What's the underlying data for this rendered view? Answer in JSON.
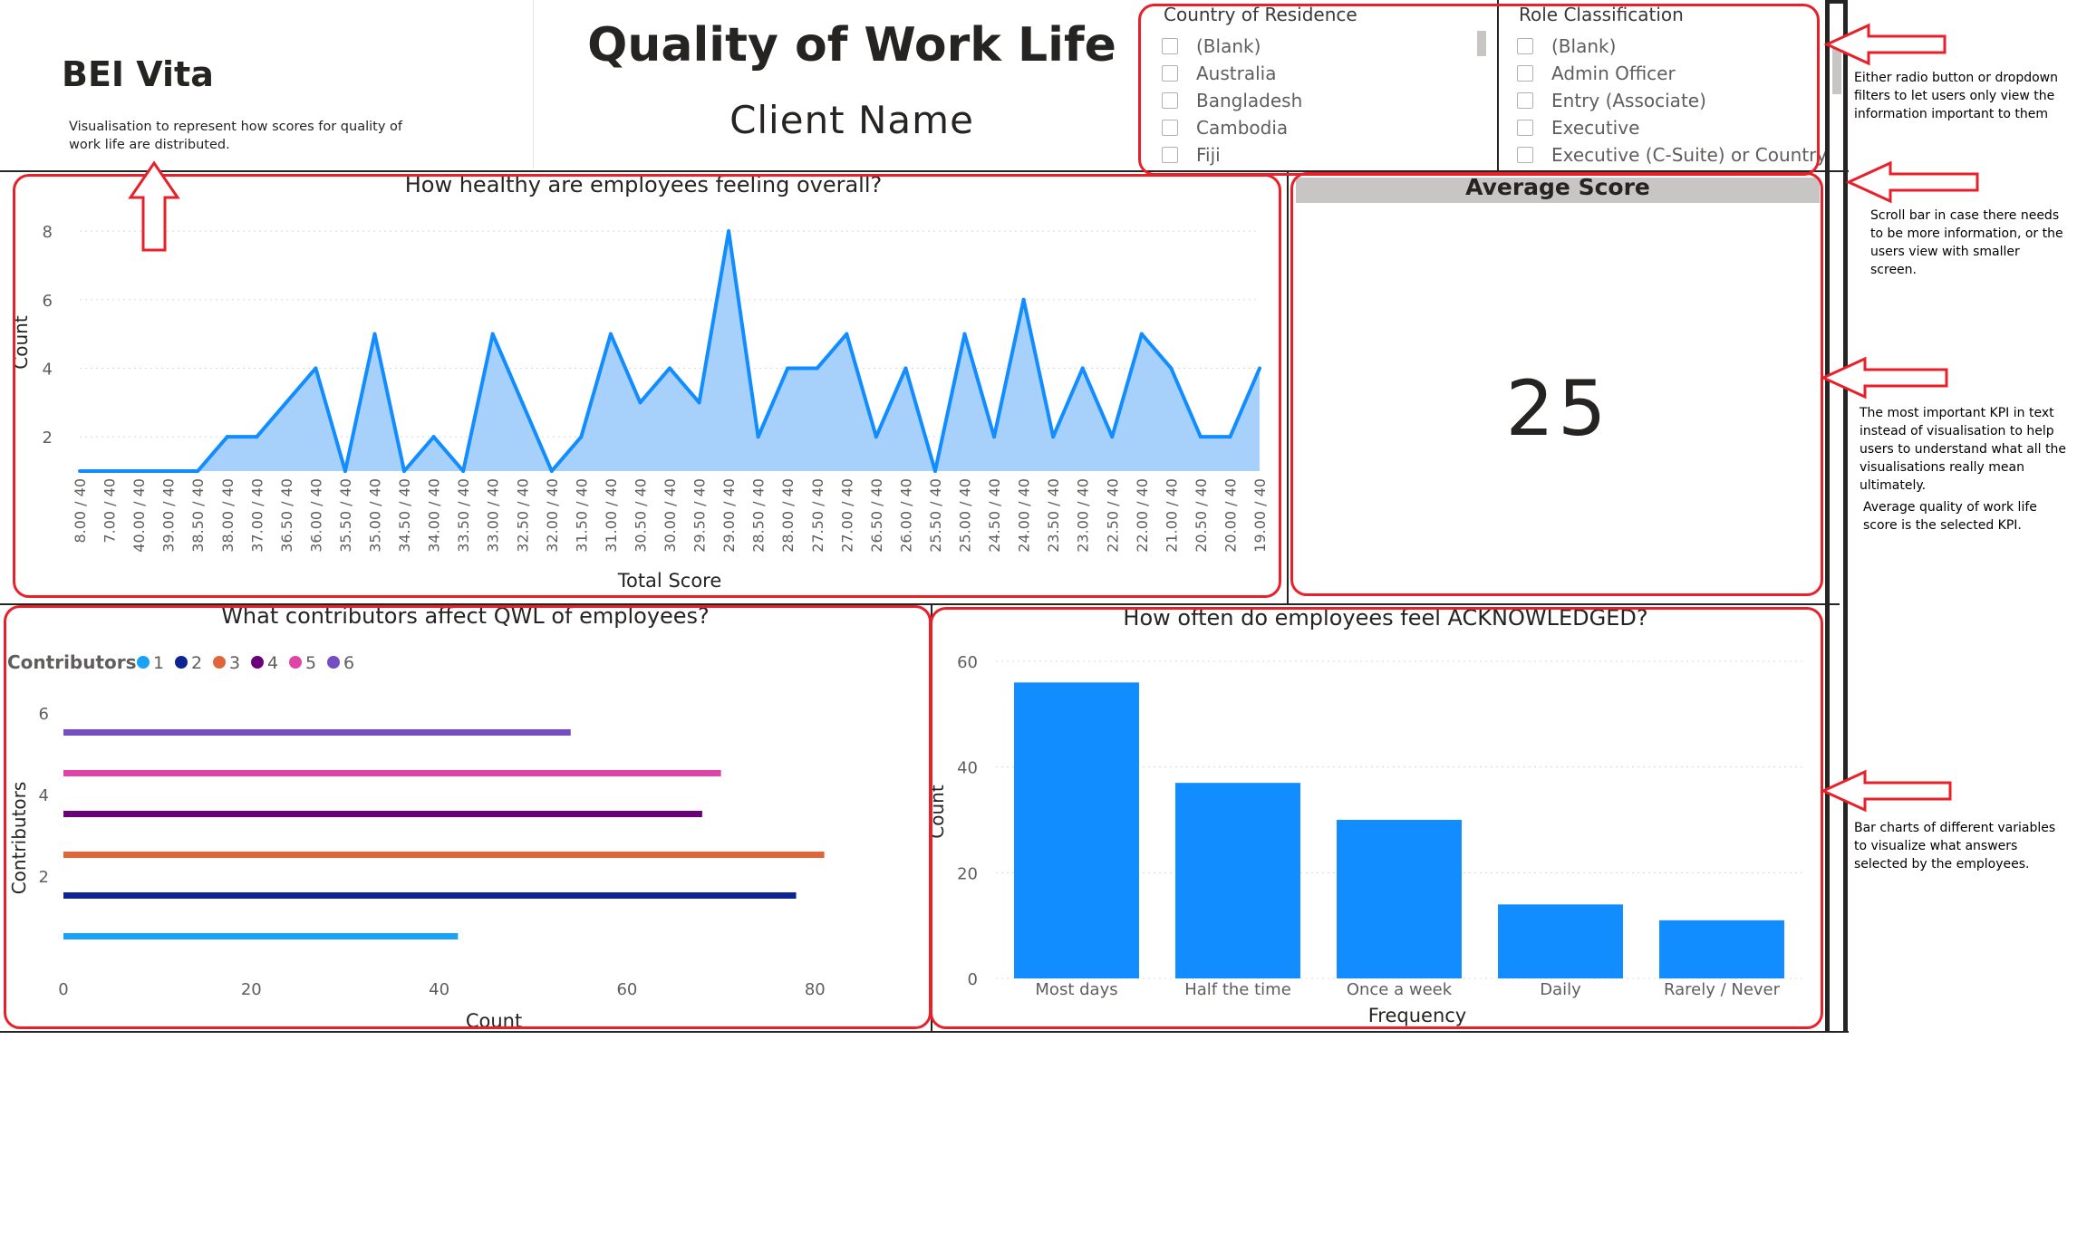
{
  "header": {
    "brand": "BEI Vita",
    "brand_description": "Visualisation to represent how scores for quality of work life are distributed.",
    "title": "Quality of Work Life",
    "client": "Client Name"
  },
  "slicers": {
    "country": {
      "title": "Country of Residence",
      "options": [
        "(Blank)",
        "Australia",
        "Bangladesh",
        "Cambodia",
        "Fiji"
      ]
    },
    "role": {
      "title": "Role Classification",
      "options": [
        "(Blank)",
        "Admin Officer",
        "Entry (Associate)",
        "Executive",
        "Executive (C-Suite) or Country H"
      ]
    }
  },
  "kpi": {
    "title": "Average Score",
    "value": "25"
  },
  "annotations": {
    "filters": "Either radio button or dropdown filters to let users only view the information important to them",
    "scroll": "Scroll bar in case there needs to be more information, or the users view with smaller screen.",
    "kpi_1": "The most important KPI in text instead of visualisation to help users to understand what all the visualisations really mean ultimately.",
    "kpi_2": "Average quality of work life score is the selected KPI.",
    "bars": "Bar charts of different variables to visualize what answers selected by the employees."
  },
  "colors": {
    "accent_red": "#e8202a",
    "powerbi_blue": "#118dff",
    "area_fill": "#a7d1fb",
    "contributors": [
      "#1aa2f6",
      "#0d2491",
      "#e0663a",
      "#6b007b",
      "#e044a7",
      "#744ec2"
    ]
  },
  "chart_data": [
    {
      "type": "area",
      "title": "How healthy are employees feeling overall?",
      "xlabel": "Total Score",
      "ylabel": "Count",
      "categories": [
        "8.00 / 40",
        "7.00 / 40",
        "40.00 / 40",
        "39.00 / 40",
        "38.50 / 40",
        "38.00 / 40",
        "37.00 / 40",
        "36.50 / 40",
        "36.00 / 40",
        "35.50 / 40",
        "35.00 / 40",
        "34.50 / 40",
        "34.00 / 40",
        "33.50 / 40",
        "33.00 / 40",
        "32.50 / 40",
        "32.00 / 40",
        "31.50 / 40",
        "31.00 / 40",
        "30.50 / 40",
        "30.00 / 40",
        "29.50 / 40",
        "29.00 / 40",
        "28.50 / 40",
        "28.00 / 40",
        "27.50 / 40",
        "27.00 / 40",
        "26.50 / 40",
        "26.00 / 40",
        "25.50 / 40",
        "25.00 / 40",
        "24.50 / 40",
        "24.00 / 40",
        "23.50 / 40",
        "23.00 / 40",
        "22.50 / 40",
        "22.00 / 40",
        "21.00 / 40",
        "20.50 / 40",
        "20.00 / 40",
        "19.00 / 40"
      ],
      "values": [
        1,
        1,
        1,
        1,
        1,
        2,
        2,
        3,
        4,
        1,
        5,
        1,
        2,
        1,
        5,
        3,
        1,
        2,
        5,
        3,
        4,
        3,
        8,
        2,
        4,
        4,
        5,
        2,
        4,
        1,
        5,
        2,
        6,
        2,
        4,
        2,
        5,
        4,
        2,
        2,
        4
      ],
      "yticks": [
        2,
        4,
        6,
        8
      ],
      "ylim": [
        1,
        8.4
      ],
      "grid": true
    },
    {
      "type": "bar",
      "orientation": "horizontal",
      "title": "What contributors affect QWL of employees?",
      "legend_title": "Contributors",
      "legend_position": "top-left",
      "xlabel": "Count",
      "ylabel": "Contributors",
      "categories": [
        "1",
        "2",
        "3",
        "4",
        "5",
        "6"
      ],
      "values": [
        42,
        78,
        81,
        68,
        70,
        54
      ],
      "xticks": [
        0,
        20,
        40,
        60,
        80
      ],
      "yticks": [
        2,
        4,
        6
      ],
      "xlim": [
        0,
        82
      ]
    },
    {
      "type": "bar",
      "title": "How often do employees feel ACKNOWLEDGED?",
      "xlabel": "Frequency",
      "ylabel": "Count",
      "categories": [
        "Most days",
        "Half the time",
        "Once a week",
        "Daily",
        "Rarely / Never"
      ],
      "values": [
        56,
        37,
        30,
        14,
        11
      ],
      "yticks": [
        0,
        20,
        40,
        60
      ],
      "ylim": [
        0,
        60
      ],
      "grid": true
    }
  ]
}
